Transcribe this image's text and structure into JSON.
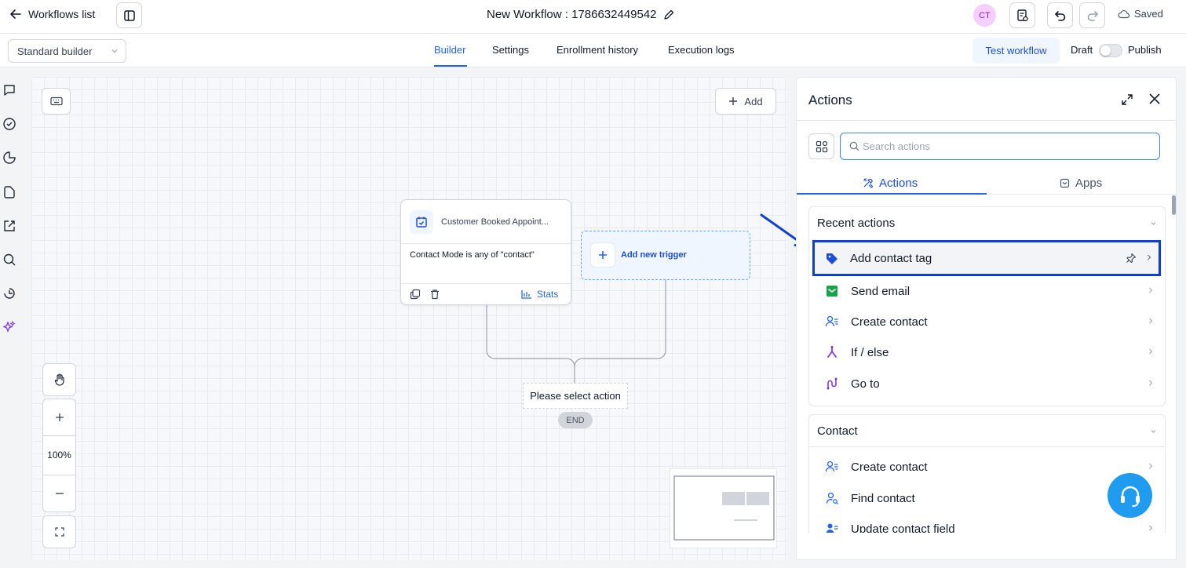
{
  "topbar": {
    "back_label": "Workflows list",
    "workflow_title": "New Workflow : 1786632449542",
    "avatar_initials": "CT",
    "saved_label": "Saved"
  },
  "subbar": {
    "builder_select": "Standard builder",
    "tabs": [
      "Builder",
      "Settings",
      "Enrollment history",
      "Execution logs"
    ],
    "active_tab": "Builder",
    "test_workflow_label": "Test workflow",
    "draft_label": "Draft",
    "publish_label": "Publish",
    "publish_toggle_on": false
  },
  "rail": {
    "icons": [
      "chat-icon",
      "check-circle-icon",
      "pie-chart-icon",
      "file-icon",
      "external-link-icon",
      "search-icon",
      "history-icon",
      "sparkles-icon"
    ]
  },
  "canvas": {
    "add_label": "Add",
    "trigger": {
      "title": "Customer Booked Appoint...",
      "condition": "Contact Mode is any of \"contact\"",
      "stats_label": "Stats"
    },
    "add_trigger_label": "Add new trigger",
    "select_action_label": "Please select action",
    "end_label": "END",
    "zoom_level": "100%"
  },
  "panel": {
    "title": "Actions",
    "search_placeholder": "Search actions",
    "tabs": [
      {
        "label": "Actions",
        "icon": "tools-icon",
        "active": true
      },
      {
        "label": "Apps",
        "icon": "app-icon",
        "active": false
      }
    ],
    "sections": [
      {
        "title": "Recent actions",
        "items": [
          {
            "label": "Add contact tag",
            "icon": "tag-icon",
            "highlighted": true
          },
          {
            "label": "Send email",
            "icon": "email-icon"
          },
          {
            "label": "Create contact",
            "icon": "user-list-icon"
          },
          {
            "label": "If / else",
            "icon": "branch-icon"
          },
          {
            "label": "Go to",
            "icon": "goto-icon"
          }
        ]
      },
      {
        "title": "Contact",
        "items": [
          {
            "label": "Create contact",
            "icon": "user-list-icon"
          },
          {
            "label": "Find contact",
            "icon": "user-search-icon"
          },
          {
            "label": "Update contact field",
            "icon": "user-edit-icon"
          }
        ]
      }
    ]
  },
  "colors": {
    "accent": "#2563eb",
    "highlight_border": "#0c3fd6",
    "tag_icon": "#1d4ed8",
    "email_icon": "#16a34a",
    "branch_icon": "#7c3aed",
    "support_button": "#1f9bf0"
  }
}
